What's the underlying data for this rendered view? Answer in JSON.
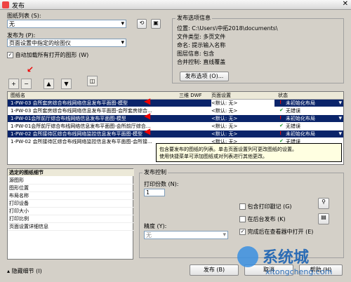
{
  "window": {
    "title": "发布"
  },
  "left_top": {
    "sheet_list_label": "图纸列表 (S):",
    "sheet_list_value": "无",
    "publish_to_label": "发布为 (P):",
    "publish_to_value": "页面设置中指定的绘图仪",
    "auto_load_label": "自动加载所有打开的图形 (W)"
  },
  "publish_info": {
    "title": "发布选项信息",
    "location": "位置: C:\\Users\\中拓2018\\documents\\",
    "file_type": "文件类型: 多页文件",
    "naming": "命名: 提示输入名称",
    "layer_info": "图层信息: 包含",
    "merge_control": "合并控制: 直线覆盖",
    "options_button": "发布选项 (O)..."
  },
  "grid": {
    "headers": [
      "图纸名",
      "三维 DWF",
      "页面设置",
      "状态"
    ],
    "rows": [
      {
        "name": "1-PW-03 会所套房综合布线网络信息发布平面图-模型",
        "setup": "<默认: 无>",
        "status": "未初始化布局",
        "status_icon": "warning",
        "selected": true
      },
      {
        "name": "1-PW-03 会所套房综合布线网络信息发布平面图-会所套房综合...",
        "setup": "<默认: 无>",
        "status": "无错误",
        "status_icon": "ok",
        "selected": false
      },
      {
        "name": "1-PW-01会所前厅综合布线网络信息发布平面图-模型",
        "setup": "<默认: 无>",
        "status": "未初始化布局",
        "status_icon": "warning",
        "selected": true
      },
      {
        "name": "1-PW-01会所前厅综合布线网络信息发布平面图-会所前厅综合...",
        "setup": "<默认: 无>",
        "status": "无错误",
        "status_icon": "ok",
        "selected": false
      },
      {
        "name": "1-PW-02 会所接待区综合布线网络监控信息发布平面图-模型",
        "setup": "<默认: 无>",
        "status": "未初始化布局",
        "status_icon": "warning",
        "selected": true
      },
      {
        "name": "1-PW-02 会所接待区综合布线网络监控信息发布平面图-会所接...",
        "setup": "<默认: 无>",
        "status": "无错误",
        "status_icon": "ok",
        "selected": false
      }
    ]
  },
  "tooltip": {
    "line1": "包含要发布的图纸的列表。单击页面设置列可更改图纸的设置。",
    "line2": "使用快捷菜单可添加图纸或对列表进行其他更改。"
  },
  "details": {
    "title": "选定的图纸细节",
    "items": [
      "源图形",
      "图形位置",
      "布局名称",
      "打印设备",
      "打印大小",
      "打印比例",
      "页面设置详细信息"
    ]
  },
  "publish_control": {
    "title": "发布控制",
    "copies_label": "打印份数 (N):",
    "copies_value": "1",
    "precision_label": "精度 (Y):",
    "precision_value": "无",
    "include_stamp": "包含打印戳记 (G)",
    "background": "在后台发布 (K)",
    "open_viewer": "完成后在查看器中打开 (E)"
  },
  "footer": {
    "hide_details": "隐藏细节 (I)",
    "publish_button": "发布 (B)",
    "cancel_button": "取消",
    "help_button": "帮助 (H)"
  },
  "watermark": {
    "brand": "系统城",
    "url": "xitongcheng.com"
  }
}
